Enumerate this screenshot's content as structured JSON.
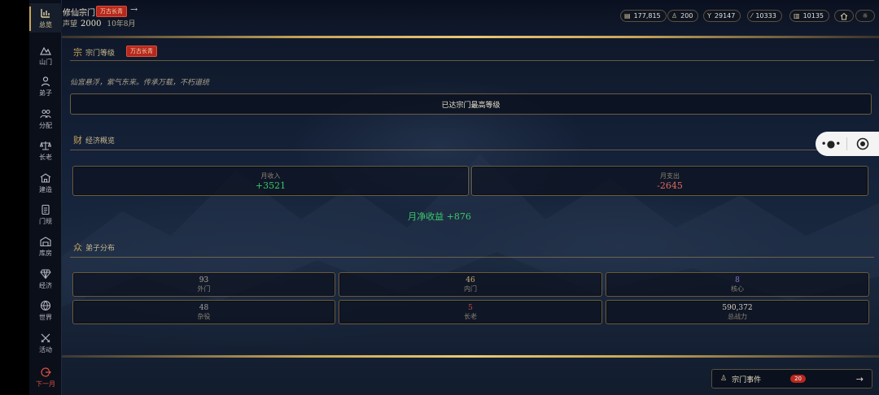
{
  "sidebar": {
    "items": [
      {
        "label": "总览",
        "icon": "bar-chart-icon"
      },
      {
        "label": "山门",
        "icon": "mountain-icon"
      },
      {
        "label": "弟子",
        "icon": "person-icon"
      },
      {
        "label": "分配",
        "icon": "people-icon"
      },
      {
        "label": "长老",
        "icon": "scale-icon"
      },
      {
        "label": "建造",
        "icon": "building-icon"
      },
      {
        "label": "门规",
        "icon": "scroll-icon"
      },
      {
        "label": "库房",
        "icon": "warehouse-icon"
      },
      {
        "label": "经济",
        "icon": "diamond-icon"
      },
      {
        "label": "世界",
        "icon": "globe-icon"
      },
      {
        "label": "活动",
        "icon": "crossed-swords-icon"
      },
      {
        "label": "下一月",
        "icon": "next-month-icon"
      }
    ]
  },
  "header": {
    "sect_name": "修仙宗门",
    "rank_badge": "万古长青",
    "fame_label": "声望",
    "fame_value": "2000",
    "date": "10年8月",
    "resources": [
      {
        "icon": "spirit-stone-icon",
        "value": "177,815"
      },
      {
        "icon": "disciple-icon",
        "value": "200"
      },
      {
        "icon": "herb-icon",
        "value": "29147"
      },
      {
        "icon": "sword-icon",
        "value": "10333"
      },
      {
        "icon": "treasure-icon",
        "value": "10135"
      }
    ]
  },
  "sect_level": {
    "glyph": "宗",
    "title": "宗门等级",
    "badge": "万古长青",
    "motto": "仙宫悬浮，紫气东来。传承万载，不朽道统",
    "status": "已达宗门最高等级"
  },
  "economy": {
    "glyph": "财",
    "title": "经济概览",
    "income_label": "月收入",
    "income_value": "+3521",
    "expense_label": "月支出",
    "expense_value": "-2645",
    "net": "月净收益 +876",
    "colors": {
      "income": "#3cc86c",
      "expense": "#e06a5a"
    }
  },
  "disciples": {
    "glyph": "众",
    "title": "弟子分布",
    "stats": [
      {
        "value": "93",
        "label": "外门"
      },
      {
        "value": "46",
        "label": "内门"
      },
      {
        "value": "8",
        "label": "核心"
      },
      {
        "value": "48",
        "label": "杂役"
      },
      {
        "value": "5",
        "label": "长老"
      },
      {
        "value": "590,372",
        "label": "总战力"
      }
    ]
  },
  "events": {
    "label": "宗门事件",
    "count": "20"
  }
}
